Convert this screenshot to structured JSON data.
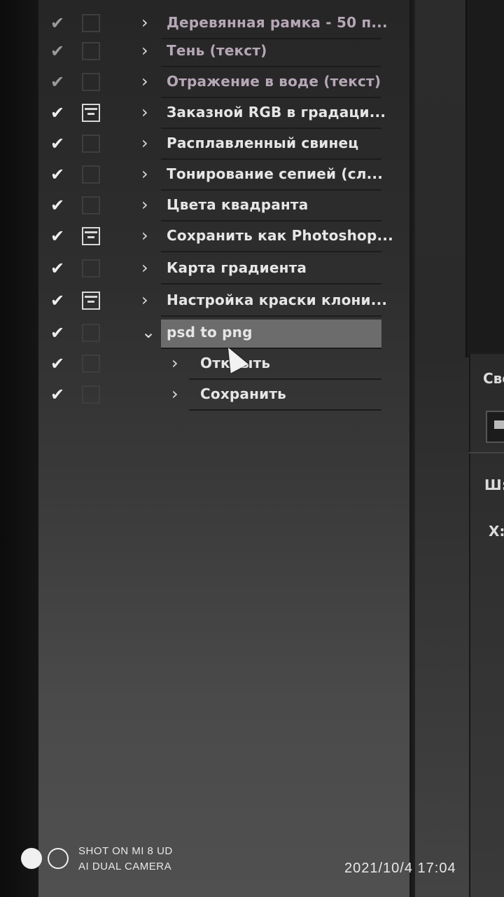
{
  "actions_panel": {
    "rows": [
      {
        "label": "Деревянная рамка - 50 п...",
        "check": "✔",
        "dialog": false,
        "chevron": "›"
      },
      {
        "label": "Тень (текст)",
        "check": "✔",
        "dialog": false,
        "chevron": "›"
      },
      {
        "label": "Отражение в воде (текст)",
        "check": "✔",
        "dialog": false,
        "chevron": "›"
      },
      {
        "label": "Заказной RGB в градаци...",
        "check": "✔",
        "dialog": true,
        "chevron": "›"
      },
      {
        "label": "Расплавленный свинец",
        "check": "✔",
        "dialog": false,
        "chevron": "›"
      },
      {
        "label": "Тонирование сепией (сл...",
        "check": "✔",
        "dialog": false,
        "chevron": "›"
      },
      {
        "label": "Цвета квадранта",
        "check": "✔",
        "dialog": false,
        "chevron": "›"
      },
      {
        "label": "Сохранить как Photoshop...",
        "check": "✔",
        "dialog": true,
        "chevron": "›"
      },
      {
        "label": "Карта градиента",
        "check": "✔",
        "dialog": false,
        "chevron": "›"
      },
      {
        "label": "Настройка краски клони...",
        "check": "✔",
        "dialog": true,
        "chevron": "›"
      },
      {
        "label": "psd to png",
        "check": "✔",
        "dialog": false,
        "chevron": "⌄",
        "selected": true
      },
      {
        "label": "Открыть",
        "check": "✔",
        "dialog": false,
        "chevron": "›",
        "sub": true
      },
      {
        "label": "Сохранить",
        "check": "✔",
        "dialog": false,
        "chevron": "›",
        "sub": true
      }
    ]
  },
  "right_panel": {
    "label_top": "Сво",
    "label_w": "Ш:",
    "label_x": "X:"
  },
  "watermark": {
    "line1": "SHOT ON MI 8 UD",
    "line2": "AI DUAL CAMERA",
    "datetime": "2021/10/4  17:04"
  }
}
